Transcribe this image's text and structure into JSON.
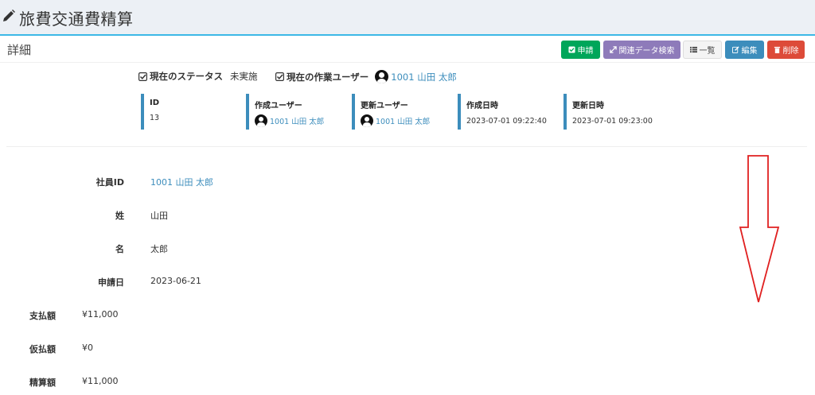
{
  "header": {
    "title": "旅費交通費精算",
    "icon": "pencil-icon"
  },
  "box": {
    "title": "詳細"
  },
  "toolbar": {
    "apply_label": "申請",
    "related_label": "関連データ検索",
    "list_label": "一覧",
    "edit_label": "編集",
    "delete_label": "削除"
  },
  "status": {
    "status_label": "現在のステータス",
    "status_value": "未実施",
    "worker_label": "現在の作業ユーザー",
    "worker_value": "1001 山田 太郎"
  },
  "meta": {
    "id_label": "ID",
    "id_value": "13",
    "creator_label": "作成ユーザー",
    "creator_value": "1001 山田 太郎",
    "updater_label": "更新ユーザー",
    "updater_value": "1001 山田 太郎",
    "created_label": "作成日時",
    "created_value": "2023-07-01 09:22:40",
    "updated_label": "更新日時",
    "updated_value": "2023-07-01 09:23:00"
  },
  "fields": {
    "employee_id_label": "社員ID",
    "employee_id_value": "1001 山田 太郎",
    "last_name_label": "姓",
    "last_name_value": "山田",
    "first_name_label": "名",
    "first_name_value": "太郎",
    "apply_date_label": "申請日",
    "apply_date_value": "2023-06-21",
    "payment_label": "支払額",
    "payment_value": "¥11,000",
    "advance_label": "仮払額",
    "advance_value": "¥0",
    "settlement_label": "精算額",
    "settlement_value": "¥11,000"
  },
  "colors": {
    "header_bg": "#ecf0f5",
    "header_border": "#3cb8e6",
    "link": "#3c8dbc",
    "apply": "#00a65a",
    "related": "#8e7bba",
    "edit": "#3c8dbc",
    "delete": "#dd4b39",
    "arrow": "#e02020"
  }
}
